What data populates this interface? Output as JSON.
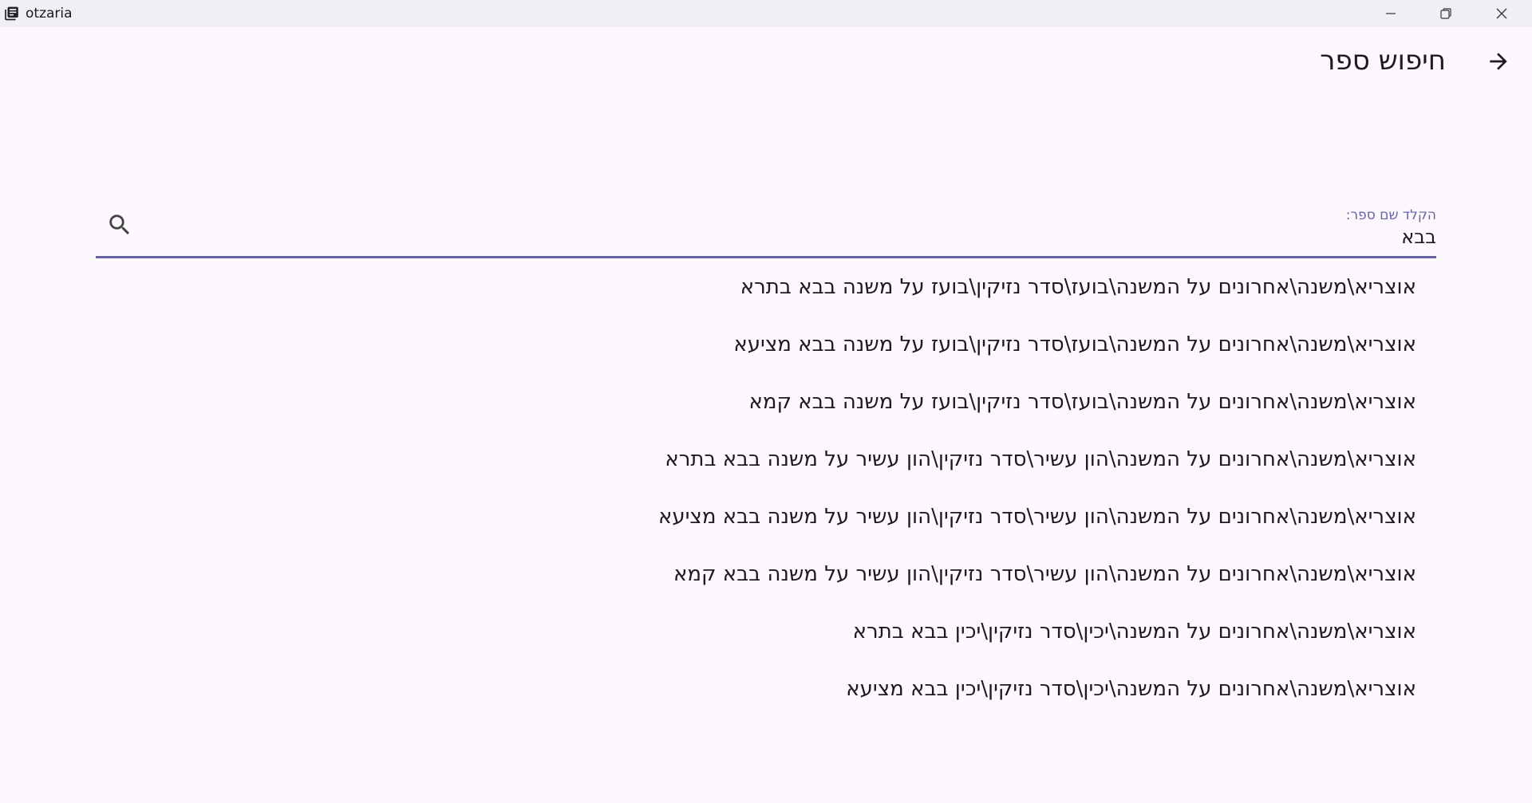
{
  "window": {
    "title": "otzaria",
    "icon": "library-books-icon",
    "controls": [
      "minimize-icon",
      "restore-icon",
      "close-icon"
    ]
  },
  "header": {
    "back_icon": "arrow-right-icon",
    "title": "חיפוש ספר"
  },
  "search": {
    "label": "הקלד שם ספר:",
    "value": "בבא",
    "icon": "search-icon",
    "accent_color": "#6561a8"
  },
  "results": [
    "אוצריא\\משנה\\אחרונים על המשנה\\בועז\\סדר נזיקין\\בועז על משנה בבא בתרא",
    "אוצריא\\משנה\\אחרונים על המשנה\\בועז\\סדר נזיקין\\בועז על משנה בבא מציעא",
    "אוצריא\\משנה\\אחרונים על המשנה\\בועז\\סדר נזיקין\\בועז על משנה בבא קמא",
    "אוצריא\\משנה\\אחרונים על המשנה\\הון עשיר\\סדר נזיקין\\הון עשיר על משנה בבא בתרא",
    "אוצריא\\משנה\\אחרונים על המשנה\\הון עשיר\\סדר נזיקין\\הון עשיר על משנה בבא מציעא",
    "אוצריא\\משנה\\אחרונים על המשנה\\הון עשיר\\סדר נזיקין\\הון עשיר על משנה בבא קמא",
    "אוצריא\\משנה\\אחרונים על המשנה\\יכין\\סדר נזיקין\\יכין בבא בתרא",
    "אוצריא\\משנה\\אחרונים על המשנה\\יכין\\סדר נזיקין\\יכין בבא מציעא"
  ]
}
